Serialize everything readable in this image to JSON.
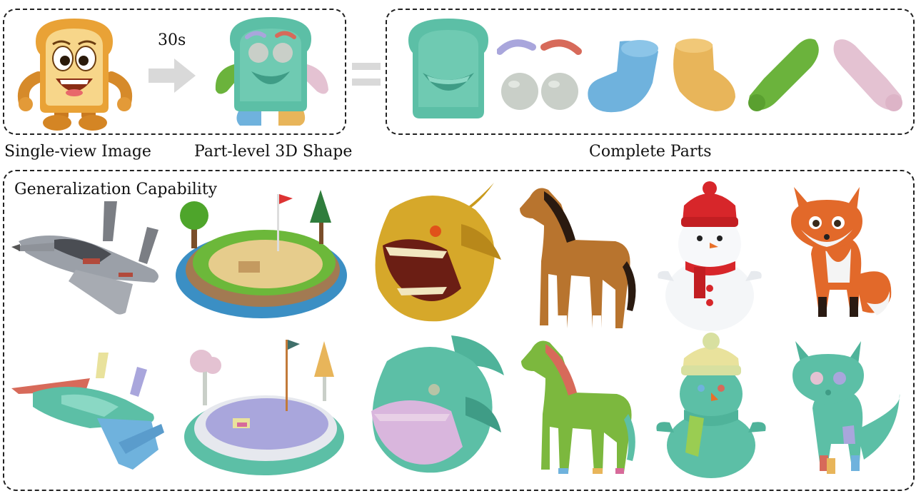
{
  "figure": {
    "labels": {
      "single_view": "Single-view Image",
      "part_level": "Part-level 3D Shape",
      "complete_parts": "Complete Parts",
      "generalization": "Generalization Capability",
      "time": "30s"
    },
    "colors": {
      "teal": "#5cbfa6",
      "teal_dark": "#3f9c86",
      "blue": "#6fb2dd",
      "yellow": "#e8b55a",
      "green": "#6bb33c",
      "pink": "#e4c2d2",
      "lavender": "#a9a6dc",
      "grey": "#c9cfc8",
      "red": "#d76a5a",
      "toast": "#e9a236",
      "toast_face": "#f7d68a",
      "arrow": "#d9d9d9"
    },
    "gallery": {
      "top_row": [
        "spaceship",
        "golf-island",
        "dragon-head",
        "horse",
        "snowman",
        "fox"
      ],
      "bottom_row": [
        "spaceship-parts",
        "golf-island-parts",
        "dragon-head-parts",
        "horse-parts",
        "snowman-parts",
        "fox-parts"
      ]
    }
  }
}
